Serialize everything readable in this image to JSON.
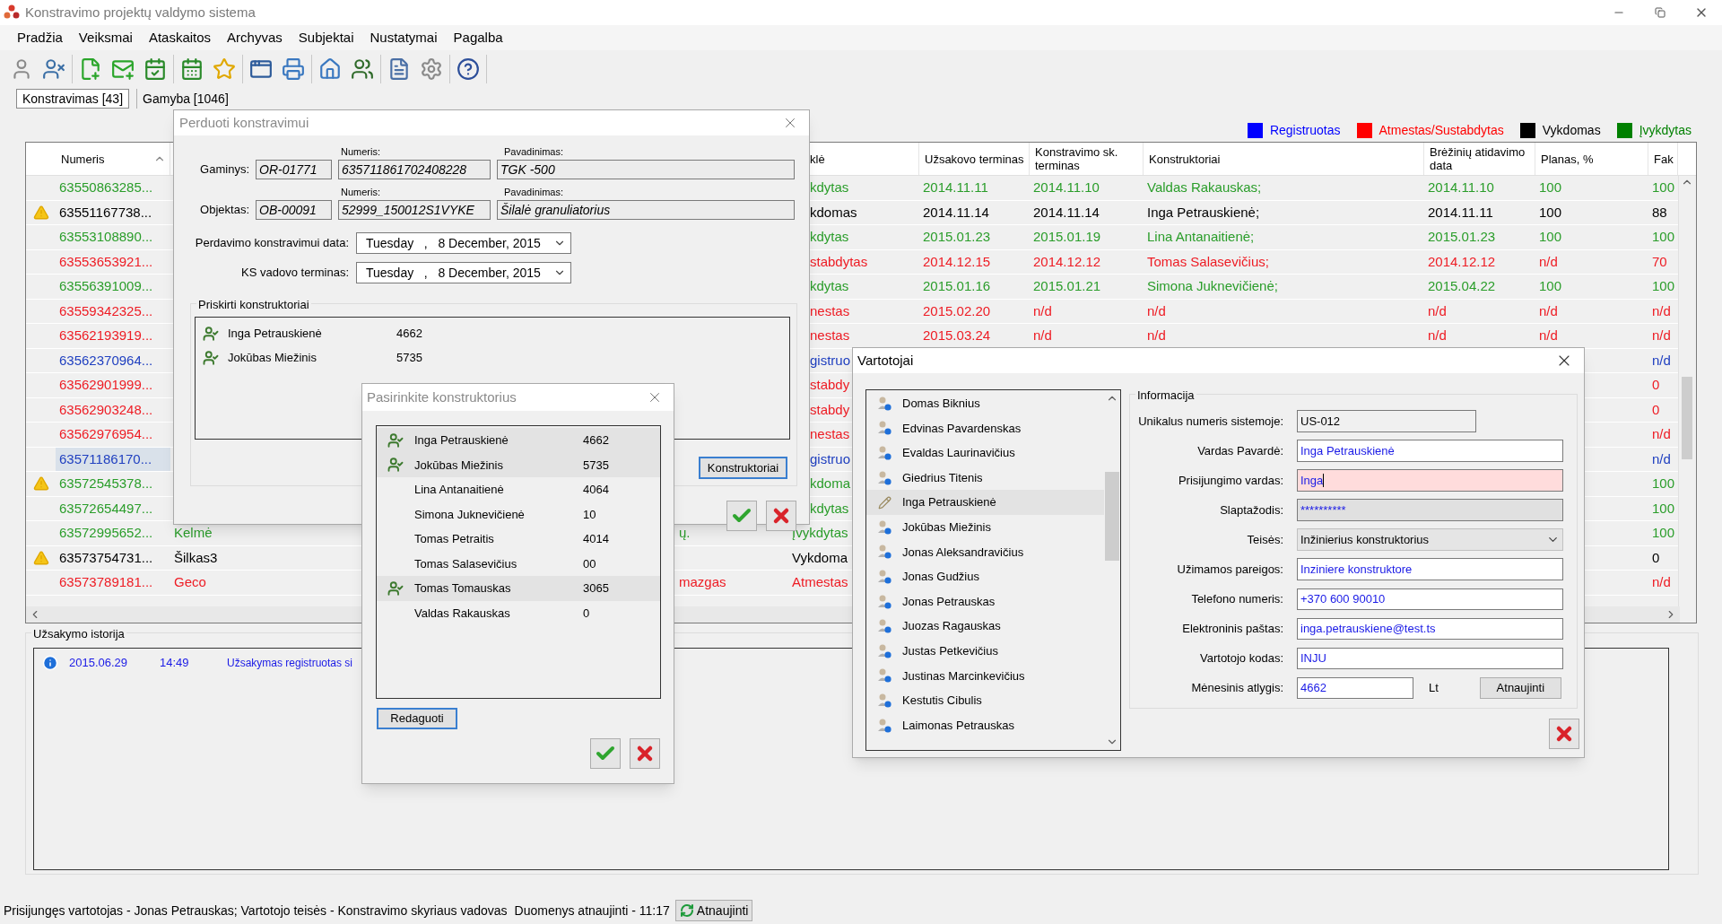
{
  "window": {
    "title": "Konstravimo projektų valdymo sistema"
  },
  "menu": [
    "Pradžia",
    "Veiksmai",
    "Ataskaitos",
    "Archyvas",
    "Subjektai",
    "Nustatymai",
    "Pagalba"
  ],
  "tabs": [
    {
      "label": "Konstravimas [43]",
      "selected": true
    },
    {
      "label": "Gamyba [1046]",
      "selected": false
    }
  ],
  "legend": [
    {
      "label": "Registruotas",
      "color": "#0000ff"
    },
    {
      "label": "Atmestas/Sustabdytas",
      "color": "#ff0000"
    },
    {
      "label": "Vykdomas",
      "color": "#000000"
    },
    {
      "label": "Įvykdytas",
      "color": "#008000"
    }
  ],
  "table": {
    "columns": [
      "Numeris",
      "klė",
      "Užsakovo terminas",
      "Konstravimo sk. terminas",
      "Konstruktoriai",
      "Brėžinių atidavimo data",
      "Planas, %",
      "Fak"
    ],
    "rows": [
      {
        "warning": false,
        "selected": false,
        "color": "#2a9d2a",
        "number": "63550863285...",
        "status": "kdytas",
        "customer_deadline": "2014.11.11",
        "design_deadline": "2014.11.10",
        "designers": "Valdas Rakauskas;",
        "drawings_date": "2014.11.10",
        "plan": "100",
        "fact": "100"
      },
      {
        "warning": true,
        "selected": false,
        "color": "#000000",
        "number": "63551167738...",
        "status": "kdomas",
        "customer_deadline": "2014.11.14",
        "design_deadline": "2014.11.14",
        "designers": "Inga Petrauskienė;",
        "drawings_date": "2014.11.11",
        "plan": "100",
        "fact": "88"
      },
      {
        "warning": false,
        "selected": false,
        "color": "#2a9d2a",
        "number": "63553108890...",
        "status": "kdytas",
        "customer_deadline": "2015.01.23",
        "design_deadline": "2015.01.19",
        "designers": "Lina Antanaitienė;",
        "drawings_date": "2015.01.23",
        "plan": "100",
        "fact": "100"
      },
      {
        "warning": false,
        "selected": false,
        "color": "#ee1c24",
        "number": "63553653921...",
        "status": "stabdytas",
        "customer_deadline": "2014.12.15",
        "design_deadline": "2014.12.12",
        "designers": "Tomas Salasevičius;",
        "drawings_date": "2014.12.12",
        "plan": "n/d",
        "fact": "70"
      },
      {
        "warning": false,
        "selected": false,
        "color": "#2a9d2a",
        "number": "63556391009...",
        "status": "kdytas",
        "customer_deadline": "2015.01.16",
        "design_deadline": "2015.01.21",
        "designers": "Simona Juknevičienė;",
        "drawings_date": "2015.04.22",
        "plan": "100",
        "fact": "100"
      },
      {
        "warning": false,
        "selected": false,
        "color": "#ee1c24",
        "number": "63559342325...",
        "status": "nestas",
        "customer_deadline": "2015.02.20",
        "design_deadline": "n/d",
        "designers": "n/d",
        "drawings_date": "n/d",
        "plan": "n/d",
        "fact": "n/d"
      },
      {
        "warning": false,
        "selected": false,
        "color": "#ee1c24",
        "number": "63562193919...",
        "status": "nestas",
        "customer_deadline": "2015.03.24",
        "design_deadline": "n/d",
        "designers": "n/d",
        "drawings_date": "n/d",
        "plan": "n/d",
        "fact": "n/d"
      },
      {
        "warning": false,
        "selected": false,
        "color": "#2040c0",
        "number": "63562370964...",
        "status": "gistruo",
        "fact": "n/d"
      },
      {
        "warning": false,
        "selected": false,
        "color": "#ee1c24",
        "number": "63562901999...",
        "status": "stabdy",
        "fact": "0"
      },
      {
        "warning": false,
        "selected": false,
        "color": "#ee1c24",
        "number": "63562903248...",
        "status": "stabdy",
        "fact": "0"
      },
      {
        "warning": false,
        "selected": false,
        "color": "#ee1c24",
        "number": "63562976954...",
        "status": "nestas",
        "fact": "n/d"
      },
      {
        "warning": false,
        "selected": true,
        "color": "#2040c0",
        "number": "63571186170...",
        "status": "gistruo",
        "fact": "n/d"
      },
      {
        "warning": true,
        "selected": false,
        "color": "#2a9d2a",
        "number": "63572545378...",
        "status": "kdoma",
        "fact": "100"
      },
      {
        "warning": false,
        "selected": false,
        "color": "#2a9d2a",
        "number": "63572654497...",
        "status": "kdytas",
        "fact": "100"
      },
      {
        "warning": false,
        "selected": false,
        "color": "#2a9d2a",
        "number": "63572995652...",
        "place": "Kelmė",
        "column_4": "ų.",
        "status": "Įvykdytas",
        "fact": "100"
      },
      {
        "warning": true,
        "selected": false,
        "color": "#000000",
        "number": "63573754731...",
        "place": "Šilkas3",
        "status": "Vykdoma",
        "fact": "0"
      },
      {
        "warning": false,
        "selected": false,
        "color": "#ee1c24",
        "number": "63573789181...",
        "place": "Geco",
        "column_4": "mazgas",
        "status": "Atmestas",
        "fact": "n/d"
      }
    ]
  },
  "history": {
    "title": "Užsakymo istorija",
    "entries": [
      {
        "date": "2015.06.29",
        "time": "14:49",
        "text": "Užsakymas registruotas si"
      }
    ]
  },
  "status_bar": {
    "text": "Prisijungęs vartotojas - Jonas Petrauskas; Vartotojo teisės - Konstravimo skyriaus vadovas",
    "updated": "Duomenys atnaujinti - 11:17",
    "button": "Atnaujinti"
  },
  "transfer_dialog": {
    "title": "Perduoti konstravimui",
    "lines": [
      {
        "label": "Gaminys:",
        "code": "OR-01771",
        "number_label": "Numeris:",
        "number": "635711861702408228",
        "name_label": "Pavadinimas:",
        "name": "TGK -500"
      },
      {
        "label": "Objektas:",
        "code": "OB-00091",
        "number_label": "Numeris:",
        "number": "52999_150012S1VYKE",
        "name_label": "Pavadinimas:",
        "name": "Šilalė granuliatorius"
      }
    ],
    "dates": [
      {
        "label": "Perdavimo konstravimui data:",
        "value": "Tuesday   ,   8 December, 2015"
      },
      {
        "label": "KS vadovo terminas:",
        "value": "Tuesday   ,   8 December, 2015"
      }
    ],
    "assigned_title": "Priskirti konstruktoriai",
    "assigned": [
      {
        "name": "Inga Petrauskienė",
        "code": "4662"
      },
      {
        "name": "Jokūbas Miežinis",
        "code": "5735"
      }
    ],
    "designers_button": "Konstruktoriai"
  },
  "choose_dialog": {
    "title": "Pasirinkite konstruktorius",
    "items": [
      {
        "name": "Inga Petrauskienė",
        "code": "4662",
        "selected": true
      },
      {
        "name": "Jokūbas Miežinis",
        "code": "5735",
        "selected": true
      },
      {
        "name": "Lina Antanaitienė",
        "code": "4064",
        "selected": false
      },
      {
        "name": "Simona Juknevičienė",
        "code": "10",
        "selected": false
      },
      {
        "name": "Tomas Petraitis",
        "code": "4014",
        "selected": false
      },
      {
        "name": "Tomas Salasevičius",
        "code": "00",
        "selected": false
      },
      {
        "name": "Tomas Tomauskas",
        "code": "3065",
        "selected": true
      },
      {
        "name": "Valdas Rakauskas",
        "code": "0",
        "selected": false
      }
    ],
    "edit_button": "Redaguoti"
  },
  "users_dialog": {
    "title": "Vartotojai",
    "users": [
      {
        "name": "Domas Biknius",
        "selected": false
      },
      {
        "name": "Edvinas Pavardenskas",
        "selected": false
      },
      {
        "name": "Evaldas Laurinavičius",
        "selected": false
      },
      {
        "name": "Giedrius Titenis",
        "selected": false
      },
      {
        "name": "Inga Petrauskienė",
        "selected": true
      },
      {
        "name": "Jokūbas Miežinis",
        "selected": false
      },
      {
        "name": "Jonas Aleksandravičius",
        "selected": false
      },
      {
        "name": "Jonas Gudžius",
        "selected": false
      },
      {
        "name": "Jonas Petrauskas",
        "selected": false
      },
      {
        "name": "Juozas Ragauskas",
        "selected": false
      },
      {
        "name": "Justas Petkevičius",
        "selected": false
      },
      {
        "name": "Justinas Marcinkevičius",
        "selected": false
      },
      {
        "name": "Kestutis Cibulis",
        "selected": false
      },
      {
        "name": "Laimonas Petrauskas",
        "selected": false
      }
    ],
    "info_title": "Informacija",
    "fields": [
      {
        "label": "Unikalus numeris sistemoje:",
        "value": "US-012",
        "kind": "readonly"
      },
      {
        "label": "Vardas Pavardė:",
        "value": "Inga Petrauskienė",
        "kind": "text"
      },
      {
        "label": "Prisijungimo vardas:",
        "value": "Inga",
        "kind": "error"
      },
      {
        "label": "Slaptažodis:",
        "value": "**********",
        "kind": "password"
      },
      {
        "label": "Teisės:",
        "value": "Inžinierius konstruktorius",
        "kind": "select"
      },
      {
        "label": "Užimamos pareigos:",
        "value": "Inziniere konstruktore",
        "kind": "text"
      },
      {
        "label": "Telefono numeris:",
        "value": "+370 600 90010",
        "kind": "text"
      },
      {
        "label": "Elektroninis paštas:",
        "value": "inga.petrauskiene@test.ts",
        "kind": "text"
      },
      {
        "label": "Vartotojo kodas:",
        "value": "INJU",
        "kind": "text"
      }
    ],
    "salary": {
      "label": "Mėnesinis atlygis:",
      "value": "4662",
      "unit": "Lt"
    },
    "update_button": "Atnaujinti"
  }
}
